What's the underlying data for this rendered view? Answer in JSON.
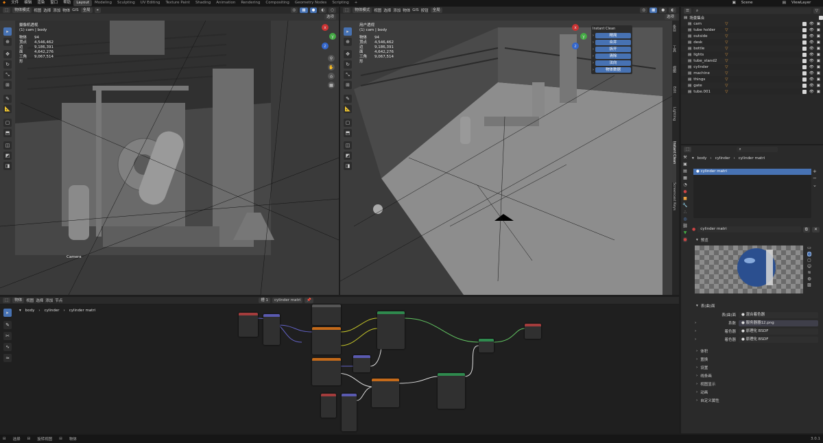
{
  "menu": {
    "items": [
      "文件",
      "编辑",
      "渲染",
      "窗口",
      "帮助"
    ],
    "workspaces": [
      "Layout",
      "Modeling",
      "Sculpting",
      "UV Editing",
      "Texture Paint",
      "Shading",
      "Animation",
      "Rendering",
      "Compositing",
      "Geometry Nodes",
      "Scripting"
    ],
    "active_workspace": "Layout",
    "scene_label": "Scene",
    "viewlayer_label": "ViewLayer"
  },
  "viewport_left": {
    "header": {
      "mode": "物体模式",
      "items": [
        "视图",
        "选择",
        "添加",
        "物体"
      ],
      "gis": "GIS",
      "transform": "全局",
      "options": "选项"
    },
    "title": "摄像机透视",
    "subtitle": "(1) cam | body",
    "stats": [
      {
        "k": "物体",
        "v": "94"
      },
      {
        "k": "顶点",
        "v": "4,546,462"
      },
      {
        "k": "边",
        "v": "9,186,391"
      },
      {
        "k": "面",
        "v": "4,642,276"
      },
      {
        "k": "三角形",
        "v": "9,067,514"
      }
    ],
    "camera_label": "Camera"
  },
  "viewport_right": {
    "header": {
      "mode": "物体模式",
      "items": [
        "视图",
        "选择",
        "添加",
        "物体"
      ],
      "gis": "GIS",
      "extra": "按钮",
      "transform": "全局",
      "options": "选项"
    },
    "title": "用户透视",
    "subtitle": "(1) cam | body",
    "stats": [
      {
        "k": "物体",
        "v": "94"
      },
      {
        "k": "顶点",
        "v": "4,546,462"
      },
      {
        "k": "边",
        "v": "9,186,391"
      },
      {
        "k": "面",
        "v": "4,642,276"
      },
      {
        "k": "三角形",
        "v": "9,067,514"
      }
    ],
    "panel": {
      "title": "Instant Clean",
      "buttons": [
        "精简",
        "合并",
        "拆开",
        "清除",
        "法向",
        "物体数据"
      ]
    },
    "side_tabs": [
      "条目",
      "工具",
      "视图",
      "Edit",
      "Lighting",
      "Instant Clean",
      "Screencast Keys"
    ]
  },
  "node_editor": {
    "header": {
      "type": "物体",
      "items": [
        "视图",
        "选择",
        "添加",
        "节点"
      ],
      "slot": "槽 1",
      "material": "cylinder matri"
    },
    "breadcrumb": [
      "body",
      "cylinder",
      "cylinder matri"
    ]
  },
  "outliner": {
    "search_placeholder": "",
    "root": "场景集合",
    "items": [
      "cam",
      "tube holder",
      "outside",
      "desk",
      "bottle",
      "lights",
      "tube_stand2",
      "cylinder",
      "machine",
      "things",
      "gate",
      "tube.001"
    ]
  },
  "properties": {
    "breadcrumb": [
      "body",
      "cylinder",
      "cylinder matri"
    ],
    "slot_selected": "cylinder matri",
    "material_name": "cylinder matri",
    "preview_label": "预览",
    "surface_label": "表(曲)面",
    "surface_rows": [
      {
        "label": "表(曲)面",
        "value": "混合着色器"
      },
      {
        "label": "系数",
        "value": "服务器器12.png"
      },
      {
        "label": "着色器",
        "value": "原理化 BSDF"
      },
      {
        "label": "着色器",
        "value": "原理化 BSDF"
      }
    ],
    "sections": [
      "体积",
      "置换",
      "设置",
      "线条画",
      "视图显示",
      "动画",
      "自定义属性"
    ]
  },
  "statusbar": {
    "left": [
      "选择",
      "旋转视图",
      "物体"
    ],
    "version": "3.0.1"
  }
}
